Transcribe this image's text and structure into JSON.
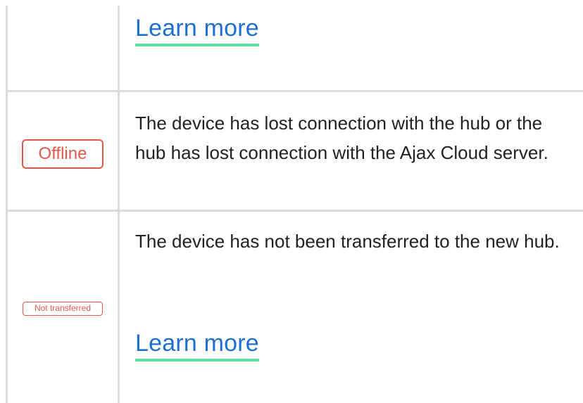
{
  "rows": [
    {
      "status": "",
      "description": "",
      "link": "Learn more"
    },
    {
      "status": "Offline",
      "description": "The device has lost connection with the hub or the hub has lost connection with the Ajax Cloud server."
    },
    {
      "status": "Not transferred",
      "description": "The device has not been transferred to the new hub.",
      "link": "Learn more"
    }
  ],
  "colors": {
    "link": "#1d6fd0",
    "link_underline": "#5ee0a6",
    "status_red": "#e2584c",
    "grid": "#dcdcdc"
  }
}
